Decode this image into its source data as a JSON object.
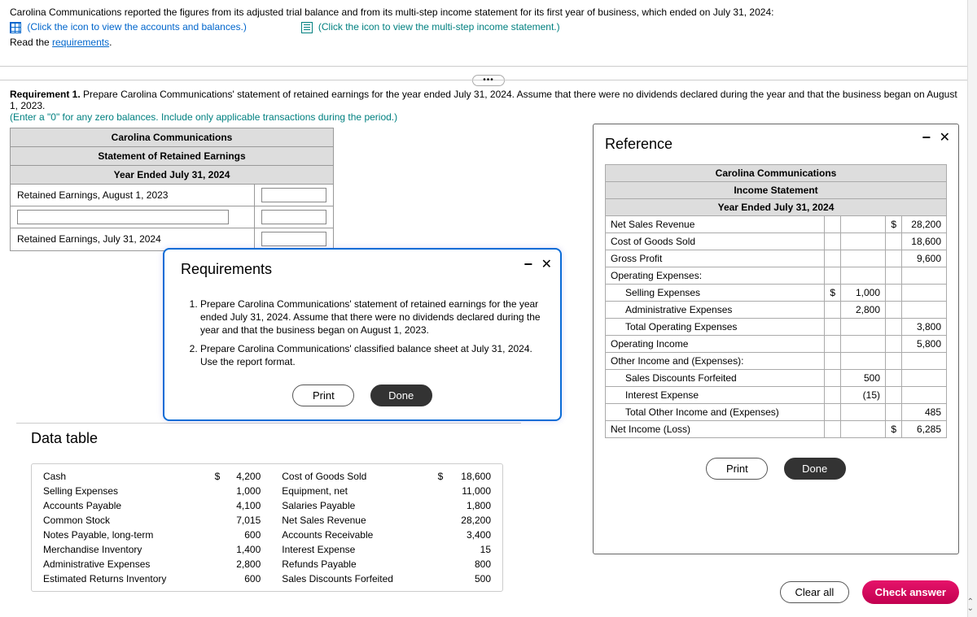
{
  "prompt": {
    "line1": "Carolina Communications reported the figures from its adjusted trial balance and from its multi-step income statement for its first year of business, which ended on July 31, 2024:",
    "link_accounts": "(Click the icon to view the accounts and balances.)",
    "link_income": "(Click the icon to view the multi-step income statement.)",
    "read_req_prefix": "Read the ",
    "read_req_link": "requirements"
  },
  "requirement1": {
    "bold": "Requirement 1.",
    "text": " Prepare Carolina Communications' statement of retained earnings for the year ended July 31, 2024. Assume that there were no dividends declared during the year and that the business began on August 1, 2023.",
    "sub": "(Enter a \"0\" for any zero balances. Include only applicable transactions during the period.)"
  },
  "stmt": {
    "h1": "Carolina Communications",
    "h2": "Statement of Retained Earnings",
    "h3": "Year Ended July 31, 2024",
    "row1": "Retained Earnings, August 1, 2023",
    "row3": "Retained Earnings, July 31, 2024"
  },
  "req_modal": {
    "title": "Requirements",
    "items": [
      "Prepare Carolina Communications' statement of retained earnings for the year ended July 31, 2024. Assume that there were no dividends declared during the year and that the business began on August 1, 2023.",
      "Prepare Carolina Communications' classified balance sheet at July 31, 2024. Use the report format."
    ],
    "print": "Print",
    "done": "Done"
  },
  "data_table": {
    "title": "Data table",
    "rows": [
      {
        "l": "Cash",
        "ld": "$",
        "lv": "4,200",
        "r": "Cost of Goods Sold",
        "rd": "$",
        "rv": "18,600"
      },
      {
        "l": "Selling Expenses",
        "ld": "",
        "lv": "1,000",
        "r": "Equipment, net",
        "rd": "",
        "rv": "11,000"
      },
      {
        "l": "Accounts Payable",
        "ld": "",
        "lv": "4,100",
        "r": "Salaries Payable",
        "rd": "",
        "rv": "1,800"
      },
      {
        "l": "Common Stock",
        "ld": "",
        "lv": "7,015",
        "r": "Net Sales Revenue",
        "rd": "",
        "rv": "28,200"
      },
      {
        "l": "Notes Payable, long-term",
        "ld": "",
        "lv": "600",
        "r": "Accounts Receivable",
        "rd": "",
        "rv": "3,400"
      },
      {
        "l": "Merchandise Inventory",
        "ld": "",
        "lv": "1,400",
        "r": "Interest Expense",
        "rd": "",
        "rv": "15"
      },
      {
        "l": "Administrative Expenses",
        "ld": "",
        "lv": "2,800",
        "r": "Refunds Payable",
        "rd": "",
        "rv": "800"
      },
      {
        "l": "Estimated Returns Inventory",
        "ld": "",
        "lv": "600",
        "r": "Sales Discounts Forfeited",
        "rd": "",
        "rv": "500"
      }
    ]
  },
  "reference": {
    "title": "Reference",
    "h1": "Carolina Communications",
    "h2": "Income Statement",
    "h3": "Year Ended July 31, 2024",
    "rows": [
      {
        "label": "Net Sales Revenue",
        "c1": "",
        "c2": "",
        "c3": "$",
        "c4": "28,200"
      },
      {
        "label": "Cost of Goods Sold",
        "c1": "",
        "c2": "",
        "c3": "",
        "c4": "18,600"
      },
      {
        "label": "Gross Profit",
        "c1": "",
        "c2": "",
        "c3": "",
        "c4": "9,600"
      },
      {
        "label": "Operating Expenses:",
        "c1": "",
        "c2": "",
        "c3": "",
        "c4": ""
      },
      {
        "label": "Selling Expenses",
        "indent": 1,
        "c1": "$",
        "c2": "1,000",
        "c3": "",
        "c4": ""
      },
      {
        "label": "Administrative Expenses",
        "indent": 1,
        "c1": "",
        "c2": "2,800",
        "c3": "",
        "c4": ""
      },
      {
        "label": "Total Operating Expenses",
        "indent": 1,
        "c1": "",
        "c2": "",
        "c3": "",
        "c4": "3,800"
      },
      {
        "label": "Operating Income",
        "c1": "",
        "c2": "",
        "c3": "",
        "c4": "5,800"
      },
      {
        "label": "Other Income and (Expenses):",
        "c1": "",
        "c2": "",
        "c3": "",
        "c4": ""
      },
      {
        "label": "Sales Discounts Forfeited",
        "indent": 1,
        "c1": "",
        "c2": "500",
        "c3": "",
        "c4": ""
      },
      {
        "label": "Interest Expense",
        "indent": 1,
        "c1": "",
        "c2": "(15)",
        "c3": "",
        "c4": ""
      },
      {
        "label": "Total Other Income and (Expenses)",
        "indent": 1,
        "c1": "",
        "c2": "",
        "c3": "",
        "c4": "485"
      },
      {
        "label": "Net Income (Loss)",
        "c1": "",
        "c2": "",
        "c3": "$",
        "c4": "6,285"
      }
    ],
    "print": "Print",
    "done": "Done"
  },
  "footer": {
    "clear": "Clear all",
    "check": "Check answer"
  }
}
